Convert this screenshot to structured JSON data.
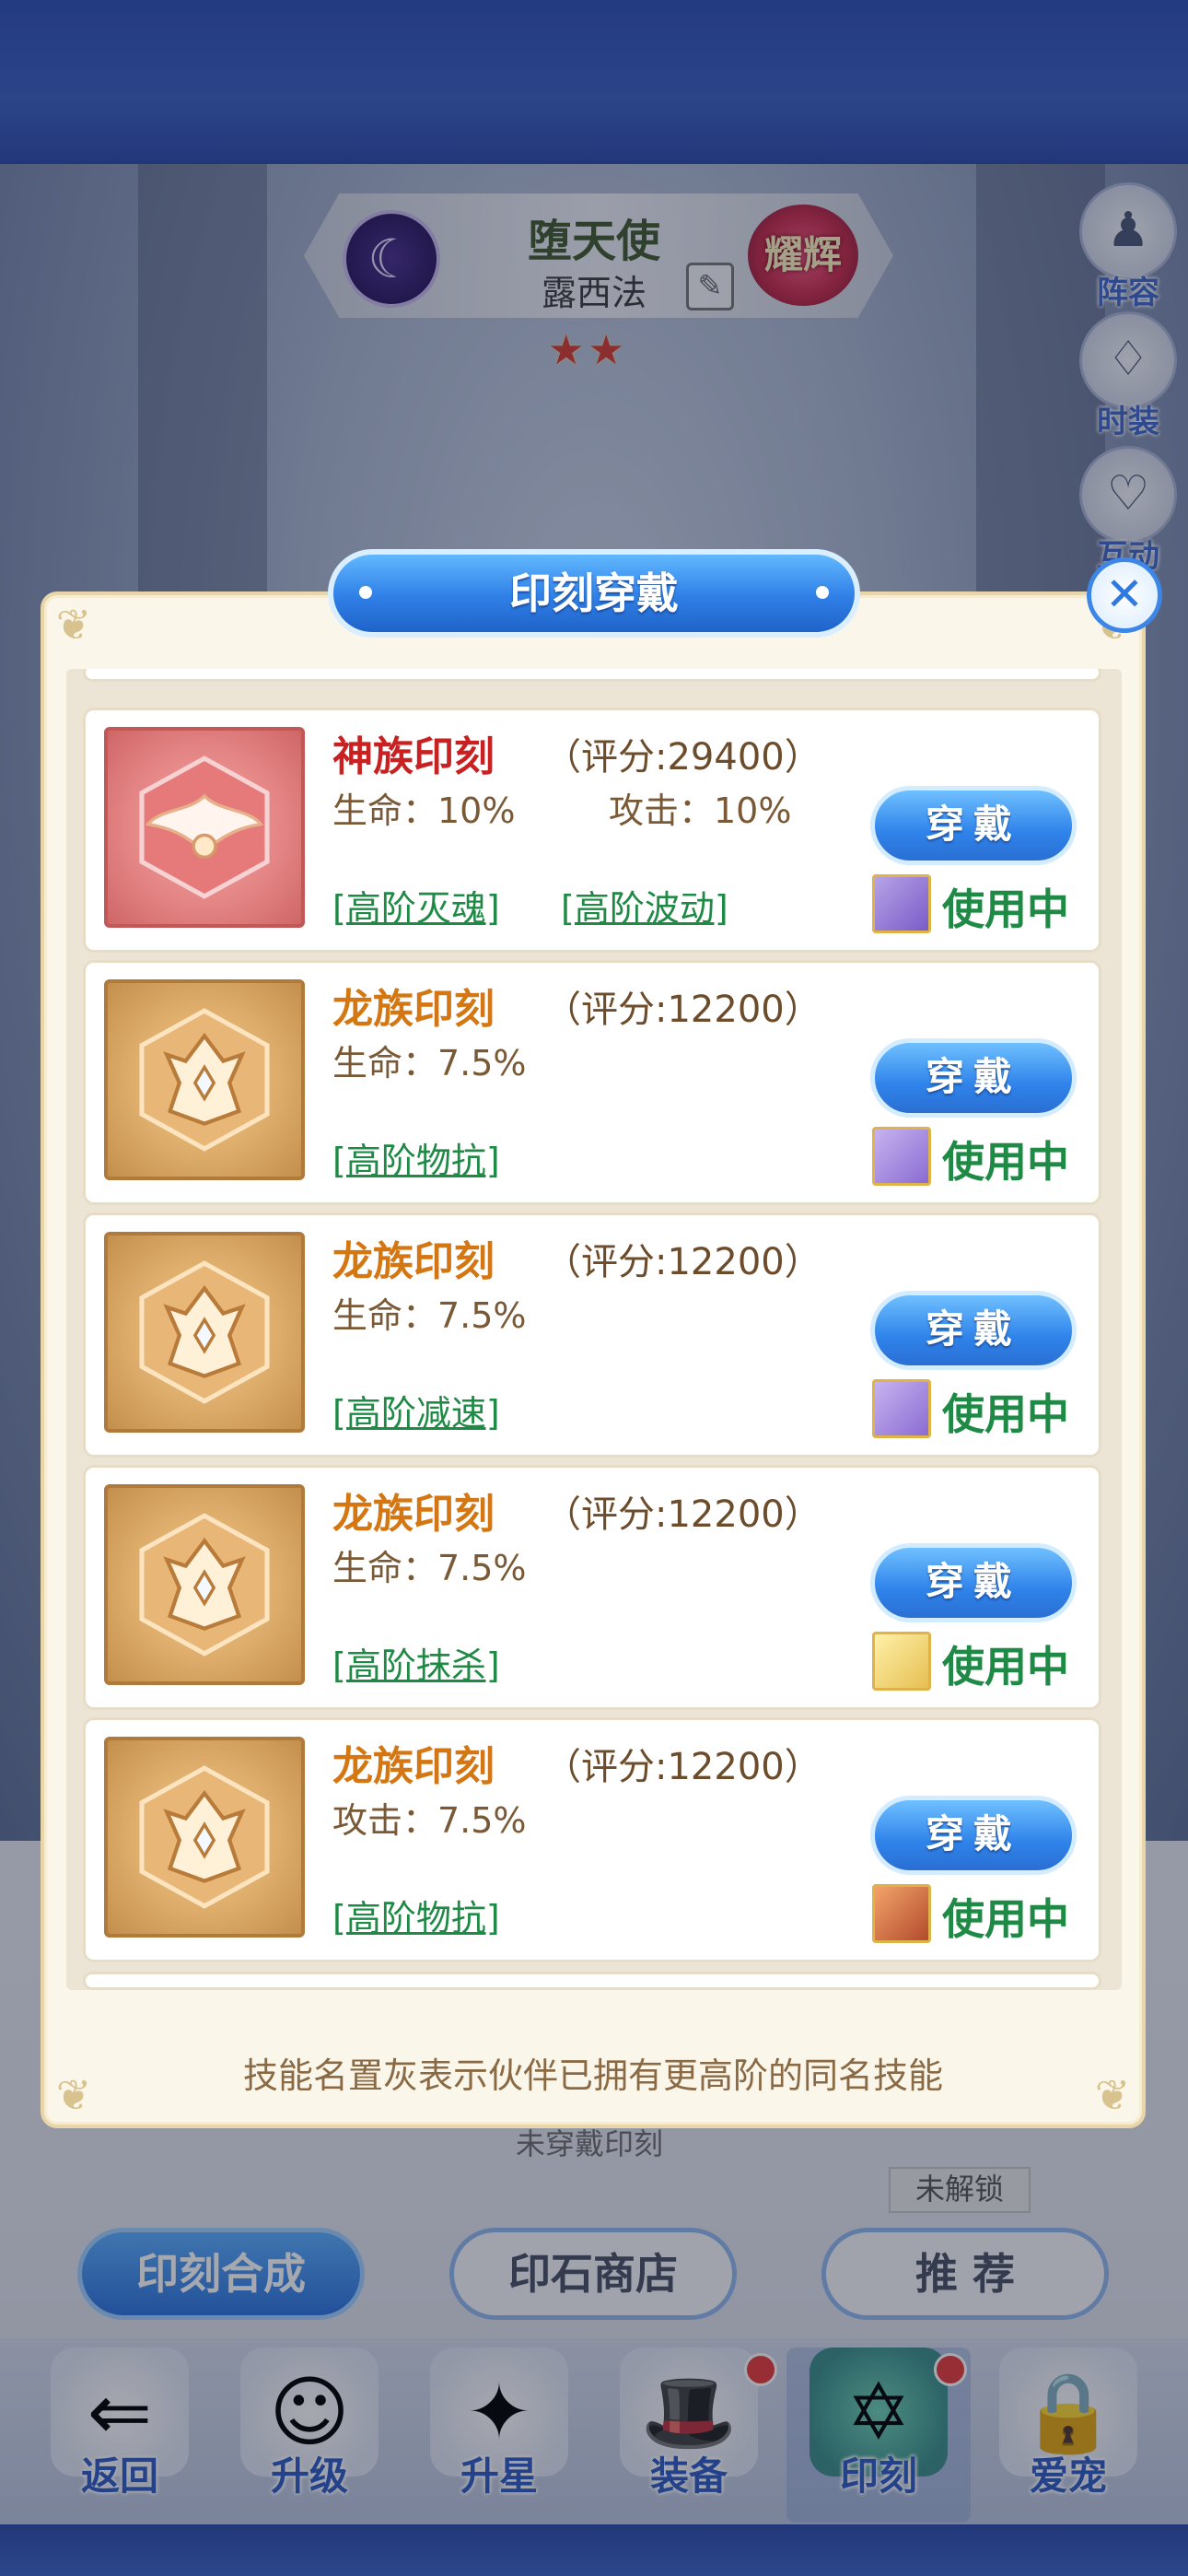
{
  "hero": {
    "title": "堕天使",
    "name": "露西法",
    "rank_badge": "耀辉",
    "stars": "★★",
    "class_icon": "crescent-moon-icon"
  },
  "side_buttons": [
    {
      "label": "阵容",
      "icon": "chess-pawn-icon"
    },
    {
      "label": "时装",
      "icon": "dress-icon"
    },
    {
      "label": "互动",
      "icon": "heart-icon"
    }
  ],
  "modal": {
    "title": "印刻穿戴",
    "footnote": "技能名置灰表示伙伴已拥有更高阶的同名技能",
    "close_icon": "close-icon"
  },
  "seals": [
    {
      "name": "神族印刻",
      "score": "（评分:29400）",
      "stat1": "生命：10%",
      "stat2": "攻击：10%",
      "skills": [
        "[高阶灭魂]",
        "[高阶波动]"
      ],
      "button": "穿戴",
      "status": "使用中",
      "kind": "god"
    },
    {
      "name": "龙族印刻",
      "score": "（评分:12200）",
      "stat1": "生命：7.5%",
      "stat2": "",
      "skills": [
        "[高阶物抗]"
      ],
      "button": "穿戴",
      "status": "使用中",
      "kind": "dragon"
    },
    {
      "name": "龙族印刻",
      "score": "（评分:12200）",
      "stat1": "生命：7.5%",
      "stat2": "",
      "skills": [
        "[高阶减速]"
      ],
      "button": "穿戴",
      "status": "使用中",
      "kind": "dragon"
    },
    {
      "name": "龙族印刻",
      "score": "（评分:12200）",
      "stat1": "生命：7.5%",
      "stat2": "",
      "skills": [
        "[高阶抹杀]"
      ],
      "button": "穿戴",
      "status": "使用中",
      "kind": "dragon"
    },
    {
      "name": "龙族印刻",
      "score": "（评分:12200）",
      "stat1": "攻击：7.5%",
      "stat2": "",
      "skills": [
        "[高阶物抗]"
      ],
      "button": "穿戴",
      "status": "使用中",
      "kind": "dragon"
    }
  ],
  "under_modal": {
    "peek_text": "未穿戴印刻",
    "locked_label": "未解锁",
    "actions": [
      "印刻合成",
      "印石商店",
      "推 荐"
    ]
  },
  "nav": [
    {
      "label": "返回",
      "icon": "back-arrow-icon"
    },
    {
      "label": "升级",
      "icon": "hero-portrait-icon"
    },
    {
      "label": "升星",
      "icon": "star-moon-icon"
    },
    {
      "label": "装备",
      "icon": "hat-icon"
    },
    {
      "label": "印刻",
      "icon": "hexagram-icon"
    },
    {
      "label": "爱宠",
      "icon": "pet-lock-icon"
    }
  ],
  "colors": {
    "accent_blue": "#2f7fe6",
    "god_seal": "#c92121",
    "dragon_seal": "#d47713",
    "in_use_green": "#1f8a45"
  }
}
